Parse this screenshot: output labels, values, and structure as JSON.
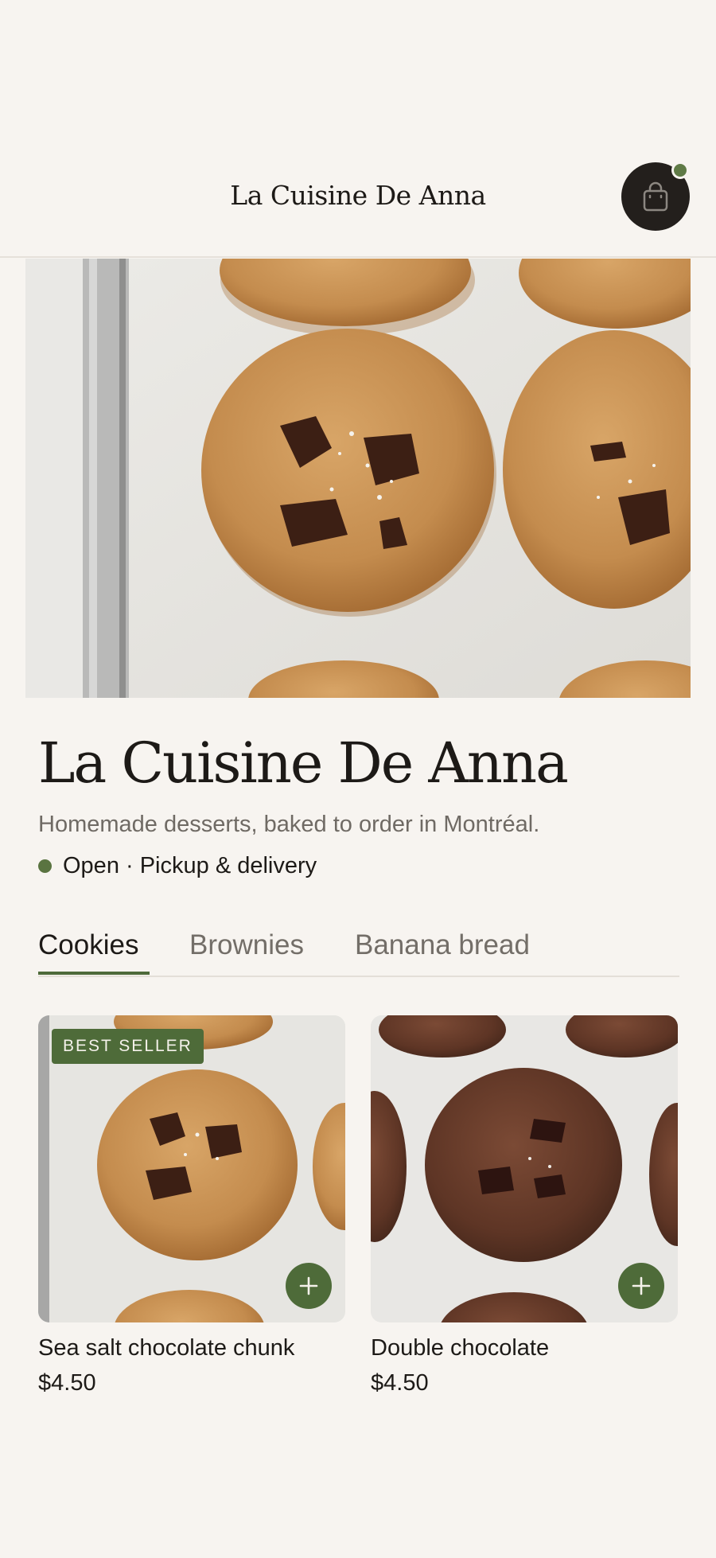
{
  "header": {
    "title": "La Cuisine De Anna",
    "cart_icon": "shopping-bag-icon",
    "cart_has_items": true
  },
  "hero": {
    "image": "chocolate-chip-cookies-on-baking-tray"
  },
  "store": {
    "name": "La Cuisine De Anna",
    "tagline": "Homemade desserts, baked to order in Montréal.",
    "status": "Open · Pickup & delivery",
    "status_color": "#5a7441"
  },
  "tabs": [
    {
      "label": "Cookies",
      "active": true
    },
    {
      "label": "Brownies",
      "active": false
    },
    {
      "label": "Banana bread",
      "active": false
    }
  ],
  "products": [
    {
      "name": "Sea salt chocolate chunk",
      "price": "$4.50",
      "badge": "BEST SELLER",
      "image": "sea-salt-chocolate-chunk-cookie"
    },
    {
      "name": "Double chocolate",
      "price": "$4.50",
      "badge": "",
      "image": "double-chocolate-cookie"
    }
  ],
  "colors": {
    "background": "#f7f4f0",
    "accent_green": "#4e6b39",
    "dark": "#231f1c"
  }
}
